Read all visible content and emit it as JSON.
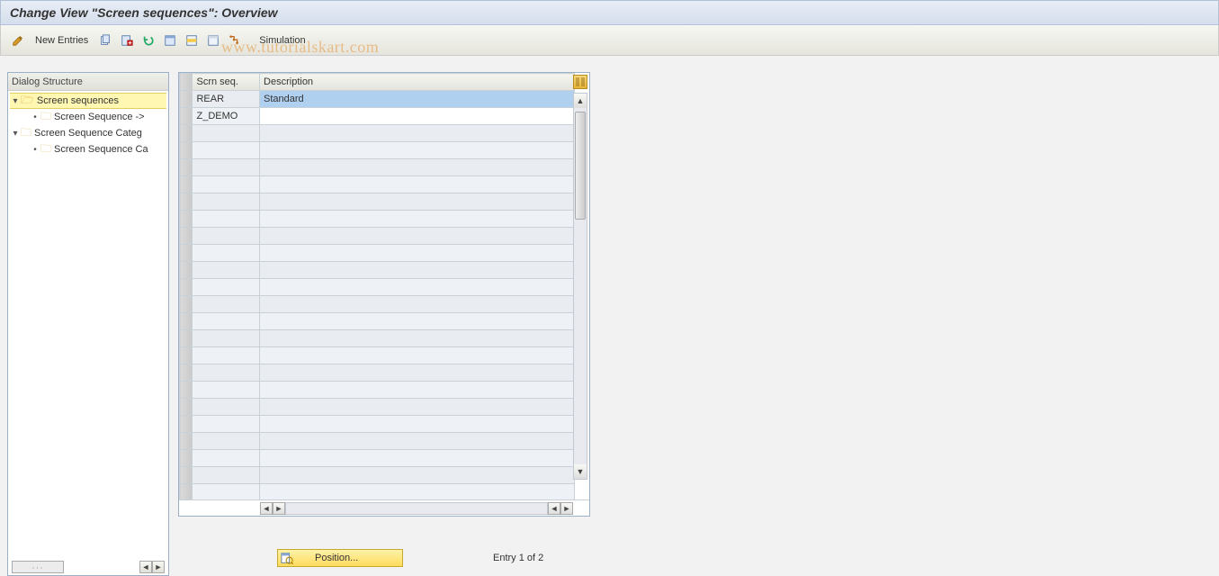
{
  "title": "Change View \"Screen sequences\": Overview",
  "toolbar": {
    "new_entries_label": "New Entries",
    "simulation_label": "Simulation"
  },
  "tree": {
    "header": "Dialog Structure",
    "items": [
      {
        "label": "Screen sequences",
        "open": true,
        "level": 0,
        "selected": true
      },
      {
        "label": "Screen Sequence ->",
        "open": false,
        "level": 1,
        "selected": false
      },
      {
        "label": "Screen Sequence Categ",
        "open": false,
        "level": 0,
        "selected": false,
        "toggle": true
      },
      {
        "label": "Screen Sequence Ca",
        "open": false,
        "level": 1,
        "selected": false
      }
    ]
  },
  "table": {
    "columns": {
      "seq": "Scrn seq.",
      "desc": "Description"
    },
    "rows": [
      {
        "seq": "REAR",
        "desc": "Standard",
        "highlight": true
      },
      {
        "seq": "Z_DEMO",
        "desc": "",
        "editable_desc": true
      }
    ],
    "empty_row_count": 22
  },
  "footer": {
    "position_label": "Position...",
    "entry_text": "Entry 1 of 2"
  },
  "watermark": "www.tutorialskart.com",
  "icons": {
    "pencil": "pencil-icon",
    "copy": "copy-icon",
    "save": "save-variant-icon",
    "undo": "undo-icon",
    "select_all": "select-all-icon",
    "select_block": "select-block-icon",
    "deselect": "deselect-icon",
    "print": "tree-collapse-icon"
  }
}
